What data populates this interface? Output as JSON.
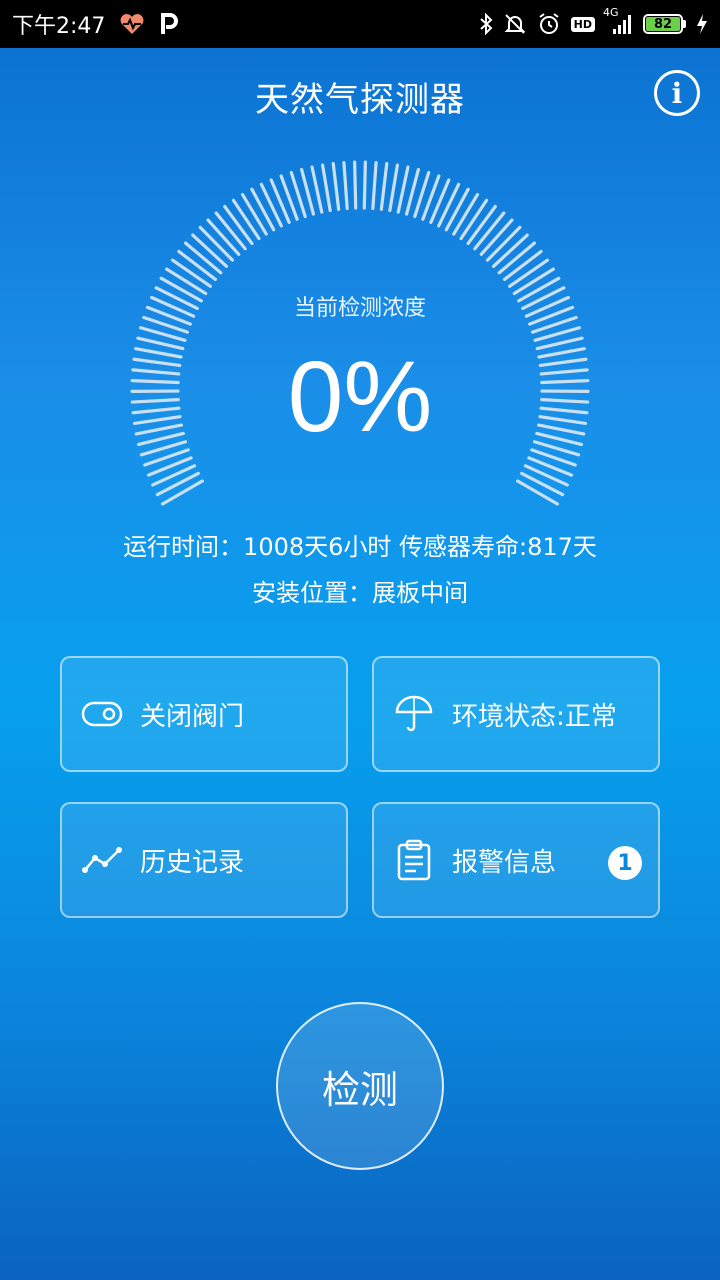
{
  "status_bar": {
    "time": "下午2:47",
    "network": "4G",
    "hd": "HD",
    "battery": "82"
  },
  "header": {
    "title": "天然气探测器",
    "info_symbol": "i"
  },
  "gauge": {
    "label": "当前检测浓度",
    "value": "0%",
    "level": 0
  },
  "info": {
    "runtime": "运行时间：1008天6小时 传感器寿命:817天",
    "location": "安装位置：展板中间"
  },
  "cards": {
    "valve": "关闭阀门",
    "environment": "环境状态:正常",
    "history": "历史记录",
    "alarm": "报警信息",
    "alarm_count": "1"
  },
  "detect": {
    "label": "检测"
  },
  "colors": {
    "accent": "#07a0ee",
    "tick": "#c9dff2",
    "battery": "#6ad04a"
  }
}
